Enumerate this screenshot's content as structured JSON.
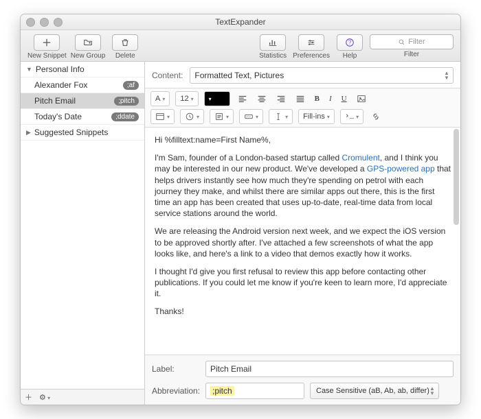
{
  "window": {
    "title": "TextExpander"
  },
  "toolbar": {
    "newSnippet": "New Snippet",
    "newGroup": "New Group",
    "delete": "Delete",
    "statistics": "Statistics",
    "preferences": "Preferences",
    "help": "Help",
    "filterLabel": "Filter",
    "filterPlaceholder": "Filter"
  },
  "sidebar": {
    "groups": [
      {
        "name": "Personal Info",
        "expanded": true,
        "items": [
          {
            "label": "Alexander Fox",
            "abbr": ";af",
            "selected": false
          },
          {
            "label": "Pitch Email",
            "abbr": ";pitch",
            "selected": true
          },
          {
            "label": "Today's Date",
            "abbr": ";ddate",
            "selected": false
          }
        ]
      },
      {
        "name": "Suggested Snippets",
        "expanded": false,
        "items": []
      }
    ]
  },
  "detail": {
    "contentLabel": "Content:",
    "contentType": "Formatted Text, Pictures",
    "fontFamilyBtn": "A",
    "fontSize": "12",
    "fillinsLabel": "Fill-ins",
    "bodyLines": {
      "p1a": "Hi ",
      "p1b": "%filltext:name=First Name%",
      "p1c": ",",
      "p2a": "I'm Sam, founder of a London-based startup called ",
      "p2link1": "Cromulent",
      "p2b": ", and I think you may be interested in our new product. We've developed a ",
      "p2link2": "GPS-powered app",
      "p2c": " that helps drivers instantly see how much they're spending on petrol with each journey they make, and whilst there are similar apps out there, this is the first time an app has been created that uses up-to-date, real-time data from local service stations around the world.",
      "p3": "We are releasing the Android version next week, and we expect the iOS version to be approved shortly after. I've attached a few screenshots of what the app looks like, and here's a link to a video that demos exactly how it works.",
      "p4": "I thought I'd give you first refusal to review this app before contacting other publications. If you could let me know if you're keen to learn more, I'd appreciate it.",
      "p5": "Thanks!"
    },
    "labelFieldLabel": "Label:",
    "labelFieldValue": "Pitch Email",
    "abbrFieldLabel": "Abbreviation:",
    "abbrFieldValue": ";pitch",
    "caseLabel": "Case Sensitive (aB, Ab, ab, differ)"
  },
  "icons": {
    "plus": "＋",
    "gear": "⚙"
  }
}
